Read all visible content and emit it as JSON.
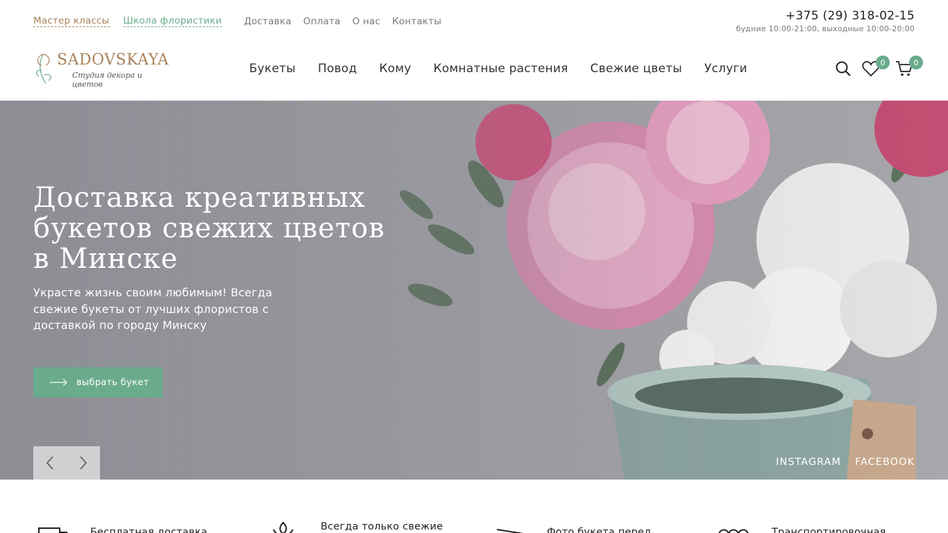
{
  "topbar": {
    "links": [
      {
        "label": "Мастер классы"
      },
      {
        "label": "Школа флористики"
      },
      {
        "label": "Доставка"
      },
      {
        "label": "Оплата"
      },
      {
        "label": "О нас"
      },
      {
        "label": "Контакты"
      }
    ],
    "phone": "+375 (29) 318-02-15",
    "hours": "будние 10:00-21:00, выходные 10:00-20:00"
  },
  "logo": {
    "name": "SADOVSKAYA",
    "tagline": "Студия декора и цветов"
  },
  "nav": {
    "items": [
      {
        "label": "Букеты"
      },
      {
        "label": "Повод"
      },
      {
        "label": "Кому"
      },
      {
        "label": "Комнатные растения"
      },
      {
        "label": "Свежие цветы"
      },
      {
        "label": "Услуги"
      }
    ]
  },
  "header_icons": {
    "favorites_count": "0",
    "cart_count": "0"
  },
  "hero": {
    "title": "Доставка креативных букетов свежих цветов в Минске",
    "subtitle": "Украсте жизнь своим любимым! Всегда свежие букеты от лучших флористов с доставкой по городу Минску",
    "button_label": "выбрать букет",
    "social": [
      "INSTAGRAM",
      "FACEBOOK"
    ]
  },
  "features": [
    {
      "label": "Бесплатная доставка"
    },
    {
      "label": "Всегда только свежие"
    },
    {
      "label": "Фото букета перед"
    },
    {
      "label": "Транспортировочная"
    }
  ],
  "colors": {
    "accent_green": "#6aab8c",
    "accent_gold": "#a9825b"
  }
}
